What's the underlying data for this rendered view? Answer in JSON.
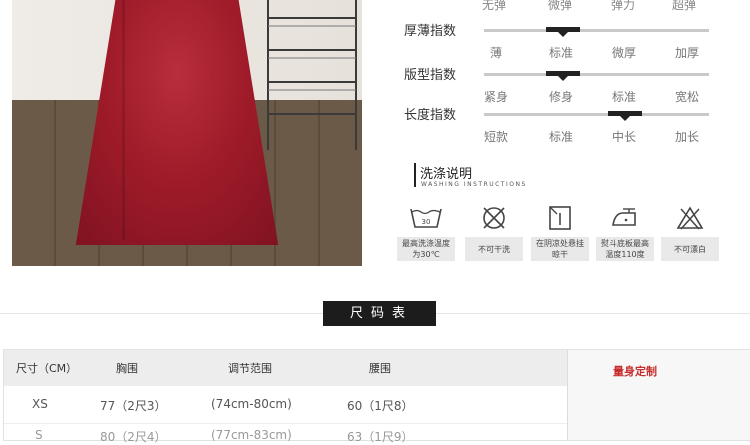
{
  "fit_indices": {
    "top_partial": [
      "无弹",
      "微弹",
      "弹力",
      "超弹"
    ],
    "rows": [
      {
        "label": "厚薄指数",
        "options": [
          "薄",
          "标准",
          "微厚",
          "加厚"
        ],
        "selected": 1
      },
      {
        "label": "版型指数",
        "options": [
          "紧身",
          "修身",
          "标准",
          "宽松"
        ],
        "selected": 1
      },
      {
        "label": "长度指数",
        "options": [
          "短款",
          "标准",
          "中长",
          "加长"
        ],
        "selected": 2
      }
    ]
  },
  "washing": {
    "title": "洗涤说明",
    "subtitle": "WASHING INSTRUCTIONS",
    "items": [
      {
        "icon": "wash-30-icon",
        "label": "最高洗涤温度为30℃"
      },
      {
        "icon": "no-dry-clean-icon",
        "label": "不可干洗"
      },
      {
        "icon": "hang-dry-shade-icon",
        "label": "在阴凉处悬挂晾干"
      },
      {
        "icon": "iron-110-icon",
        "label": "熨斗底板最高温度110度"
      },
      {
        "icon": "no-bleach-icon",
        "label": "不可漂白"
      }
    ],
    "wash_temp": "30"
  },
  "size_chart": {
    "title": "尺码表",
    "headers": [
      "尺寸（CM）",
      "胸围",
      "调节范围",
      "腰围"
    ],
    "custom_label": "量身定制",
    "rows": [
      [
        "XS",
        "77（2尺3）",
        "(74cm-80cm)",
        "60（1尺8）"
      ],
      [
        "S",
        "80（2尺4）",
        "(77cm-83cm)",
        "63（1尺9）"
      ]
    ]
  },
  "colors": {
    "accent": "#c62d2d",
    "dress": "#9f1b29",
    "title_bg": "#1c1c1c"
  }
}
